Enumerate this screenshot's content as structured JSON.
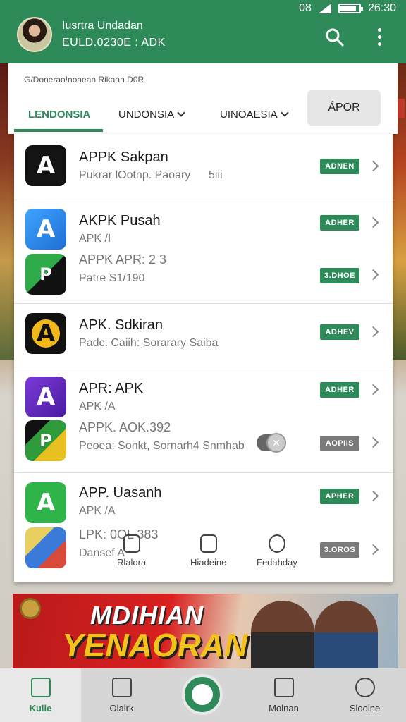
{
  "status": {
    "left": "08",
    "time": "26:30"
  },
  "header": {
    "user_name": "Iusrtra Undadan",
    "user_sub": "EULD.0230E : ADK",
    "search_icon": "search-icon",
    "more_icon": "more-vert-icon"
  },
  "panel": {
    "caption": "G/Donerao!noaean Rikaan D0R",
    "tabs": [
      {
        "label": "LENDONSIA"
      },
      {
        "label": "UNDONSIA"
      },
      {
        "label": "UINOAESIA"
      }
    ],
    "action_button": "ÁPOR"
  },
  "apps": [
    {
      "title": "APPK Sakpan",
      "line1": "Pukrar lOotnp. Paoary",
      "line1b": "5iii",
      "badge": "ADNEN"
    },
    {
      "title": "AKPK Pusah",
      "line1": "APK /I",
      "line2": "APPK APR: 2 3",
      "line3": "Patre S1/190",
      "badge": "ADHER",
      "badge2": "3.DHOE"
    },
    {
      "title": "APK. Sdkiran",
      "line1": "Padc: Caiih: Sorarary Saiba",
      "badge": "ADHEV"
    },
    {
      "title": "APR: APK",
      "line1": "APK /A",
      "line2": "APPK. AOK.392",
      "line3": "Peoea: Sonkt, Sornarh4 Snmhab",
      "badge": "ADHER",
      "badge2": "AOPIIS"
    },
    {
      "title": "APP. Uasanh",
      "line1": "APK /A",
      "line2": "LPK: 0OL 383",
      "line3": "Dansef A",
      "badge": "APHER",
      "badge2": "3.OROS"
    }
  ],
  "mini_tabs": [
    {
      "label": "Rlalora"
    },
    {
      "label": "Hiadeine"
    },
    {
      "label": "Fedahday"
    }
  ],
  "banner": {
    "line1": "MDIHIAN",
    "line2": "YENAORAN?"
  },
  "bottom_nav": [
    {
      "label": "Kulle",
      "icon": "home-icon"
    },
    {
      "label": "Olalrk",
      "icon": "mail-icon"
    },
    {
      "label": "",
      "icon": "center-action-icon"
    },
    {
      "label": "Molnan",
      "icon": "book-icon"
    },
    {
      "label": "Sloolne",
      "icon": "profile-icon"
    }
  ],
  "colors": {
    "brand": "#2f8a5a",
    "badge_gray": "#7a7a7a"
  }
}
